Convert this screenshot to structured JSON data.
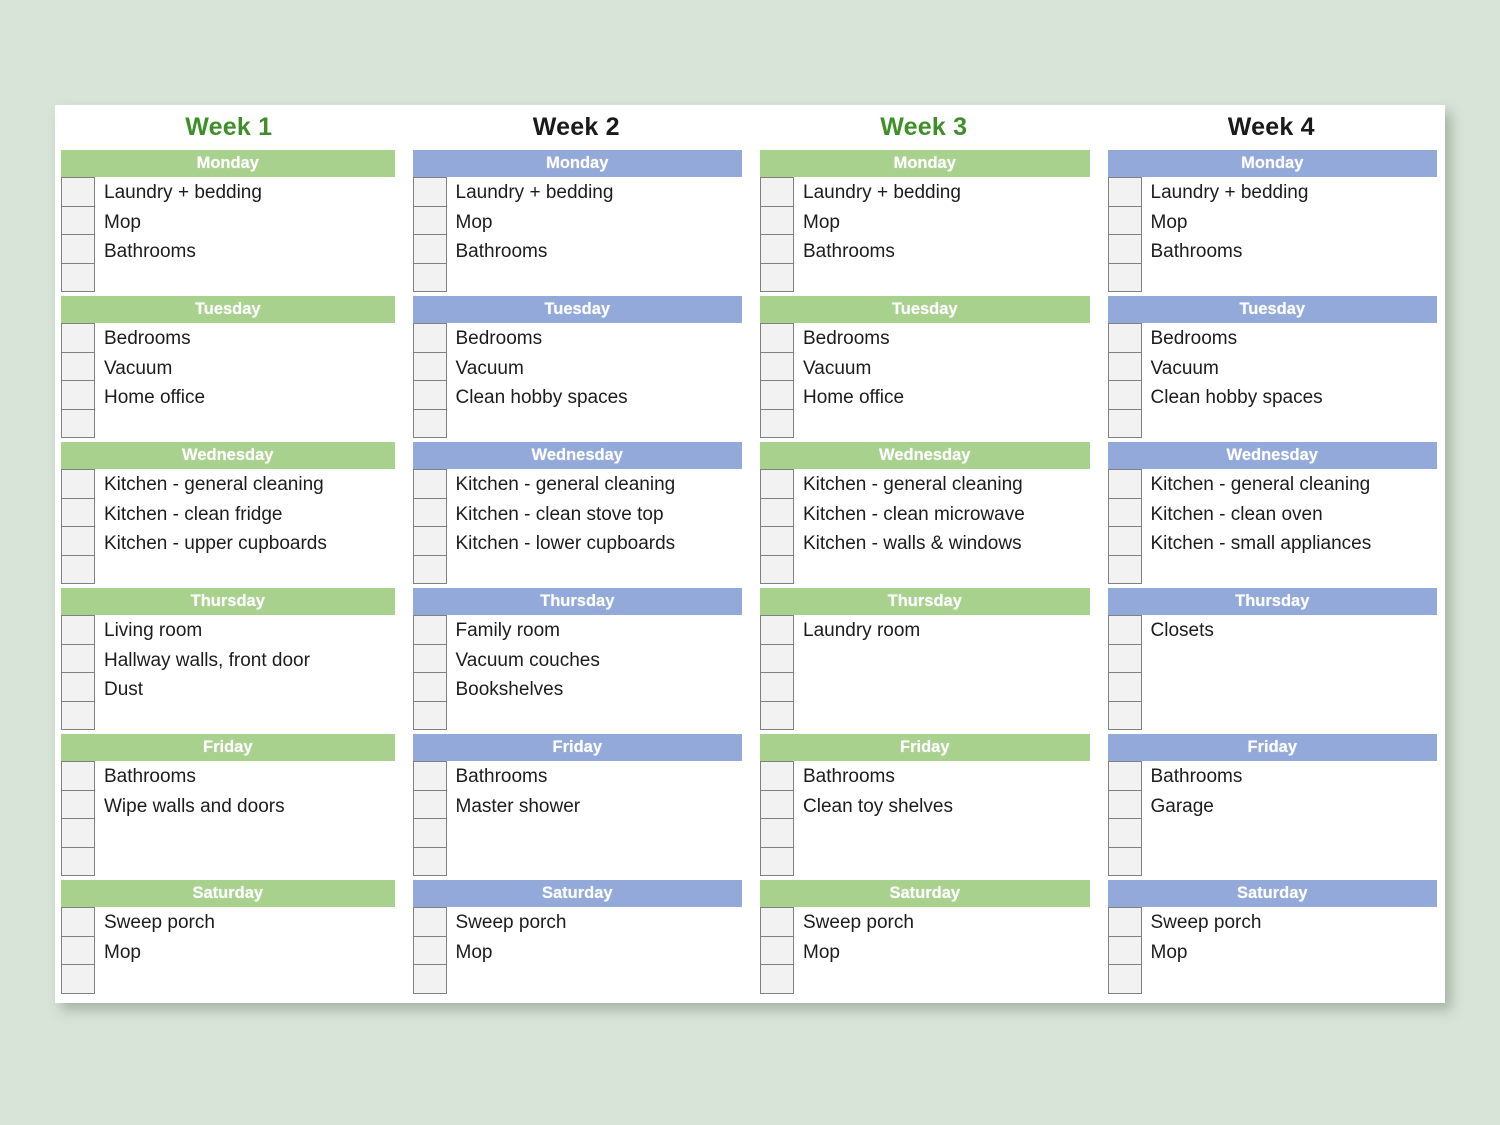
{
  "page": {
    "background_color": "#d8e4d8",
    "sheet_color": "#ffffff",
    "green_header_color": "#a9d18e",
    "blue_header_color": "#93a9d9",
    "green_title_color": "#3f8f29",
    "black_title_color": "#1a1a1a",
    "checkbox_fill": "#f2f2f2",
    "checkbox_border": "#808080"
  },
  "weeks": [
    {
      "title": "Week 1",
      "title_style": "green",
      "header_style": "green",
      "days": [
        {
          "name": "Monday",
          "checkbox_count": 4,
          "tasks": [
            "Laundry + bedding",
            "Mop",
            "Bathrooms"
          ]
        },
        {
          "name": "Tuesday",
          "checkbox_count": 4,
          "tasks": [
            "Bedrooms",
            "Vacuum",
            "Home office"
          ]
        },
        {
          "name": "Wednesday",
          "checkbox_count": 4,
          "tasks": [
            "Kitchen - general cleaning",
            "Kitchen - clean fridge",
            "Kitchen - upper cupboards"
          ]
        },
        {
          "name": "Thursday",
          "checkbox_count": 4,
          "tasks": [
            "Living room",
            "Hallway walls, front door",
            "Dust"
          ]
        },
        {
          "name": "Friday",
          "checkbox_count": 4,
          "tasks": [
            "Bathrooms",
            "Wipe walls and doors"
          ]
        },
        {
          "name": "Saturday",
          "checkbox_count": 3,
          "tasks": [
            "Sweep porch",
            "Mop"
          ]
        }
      ]
    },
    {
      "title": "Week 2",
      "title_style": "black",
      "header_style": "blue",
      "days": [
        {
          "name": "Monday",
          "checkbox_count": 4,
          "tasks": [
            "Laundry + bedding",
            "Mop",
            "Bathrooms"
          ]
        },
        {
          "name": "Tuesday",
          "checkbox_count": 4,
          "tasks": [
            "Bedrooms",
            "Vacuum",
            "Clean hobby spaces"
          ]
        },
        {
          "name": "Wednesday",
          "checkbox_count": 4,
          "tasks": [
            "Kitchen - general cleaning",
            "Kitchen - clean stove top",
            "Kitchen - lower cupboards"
          ]
        },
        {
          "name": "Thursday",
          "checkbox_count": 4,
          "tasks": [
            "Family room",
            "Vacuum couches",
            "Bookshelves"
          ]
        },
        {
          "name": "Friday",
          "checkbox_count": 4,
          "tasks": [
            "Bathrooms",
            "Master shower"
          ]
        },
        {
          "name": "Saturday",
          "checkbox_count": 3,
          "tasks": [
            "Sweep porch",
            "Mop"
          ]
        }
      ]
    },
    {
      "title": "Week 3",
      "title_style": "green",
      "header_style": "green",
      "days": [
        {
          "name": "Monday",
          "checkbox_count": 4,
          "tasks": [
            "Laundry + bedding",
            "Mop",
            "Bathrooms"
          ]
        },
        {
          "name": "Tuesday",
          "checkbox_count": 4,
          "tasks": [
            "Bedrooms",
            "Vacuum",
            "Home office"
          ]
        },
        {
          "name": "Wednesday",
          "checkbox_count": 4,
          "tasks": [
            "Kitchen - general cleaning",
            "Kitchen - clean microwave",
            "Kitchen - walls & windows"
          ]
        },
        {
          "name": "Thursday",
          "checkbox_count": 4,
          "tasks": [
            "Laundry room"
          ]
        },
        {
          "name": "Friday",
          "checkbox_count": 4,
          "tasks": [
            "Bathrooms",
            "Clean toy shelves"
          ]
        },
        {
          "name": "Saturday",
          "checkbox_count": 3,
          "tasks": [
            "Sweep porch",
            "Mop"
          ]
        }
      ]
    },
    {
      "title": "Week 4",
      "title_style": "black",
      "header_style": "blue",
      "days": [
        {
          "name": "Monday",
          "checkbox_count": 4,
          "tasks": [
            "Laundry + bedding",
            "Mop",
            "Bathrooms"
          ]
        },
        {
          "name": "Tuesday",
          "checkbox_count": 4,
          "tasks": [
            "Bedrooms",
            "Vacuum",
            "Clean hobby spaces"
          ]
        },
        {
          "name": "Wednesday",
          "checkbox_count": 4,
          "tasks": [
            "Kitchen - general cleaning",
            "Kitchen - clean oven",
            "Kitchen - small appliances"
          ]
        },
        {
          "name": "Thursday",
          "checkbox_count": 4,
          "tasks": [
            "Closets"
          ]
        },
        {
          "name": "Friday",
          "checkbox_count": 4,
          "tasks": [
            "Bathrooms",
            "Garage"
          ]
        },
        {
          "name": "Saturday",
          "checkbox_count": 3,
          "tasks": [
            "Sweep porch",
            "Mop"
          ]
        }
      ]
    }
  ]
}
